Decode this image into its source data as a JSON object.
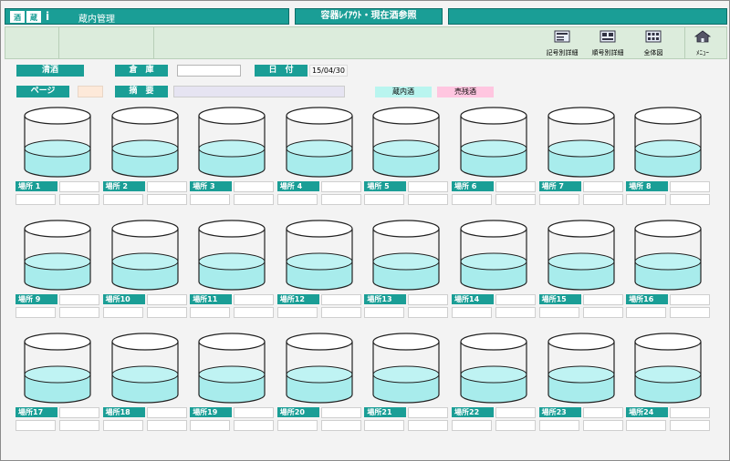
{
  "app": {
    "logo_text": "酒",
    "logo_text2": "蔵",
    "logo_i": "i",
    "title": "蔵内管理",
    "screen_title": "容器ﾚｲｱｳﾄ・現在酒参照"
  },
  "toolbar": {
    "buttons": [
      {
        "label": "記号別詳細",
        "icon": "list-detail-icon"
      },
      {
        "label": "順号別詳細",
        "icon": "order-detail-icon"
      },
      {
        "label": "全体図",
        "icon": "overview-icon"
      },
      {
        "label": "ﾒﾆｭｰ",
        "icon": "home-icon"
      }
    ]
  },
  "header": {
    "mode_label": "清酒",
    "warehouse_label": "倉　庫",
    "warehouse_value": "",
    "date_label": "日　付",
    "date_value": "15/04/30",
    "page_label": "ページ",
    "page_value": "",
    "remarks_label": "摘　要",
    "remarks_value": "",
    "legend_in_stock": "蔵内酒",
    "legend_sold": "売残酒"
  },
  "colors": {
    "teal": "#1a9e96",
    "liquid": "#a8ecec",
    "legend_in_stock": "#b9f5ef",
    "legend_sold": "#ffc6e0"
  },
  "tanks": [
    {
      "label": "場所 1"
    },
    {
      "label": "場所 2"
    },
    {
      "label": "場所 3"
    },
    {
      "label": "場所 4"
    },
    {
      "label": "場所 5"
    },
    {
      "label": "場所 6"
    },
    {
      "label": "場所 7"
    },
    {
      "label": "場所 8"
    },
    {
      "label": "場所 9"
    },
    {
      "label": "場所10"
    },
    {
      "label": "場所11"
    },
    {
      "label": "場所12"
    },
    {
      "label": "場所13"
    },
    {
      "label": "場所14"
    },
    {
      "label": "場所15"
    },
    {
      "label": "場所16"
    },
    {
      "label": "場所17"
    },
    {
      "label": "場所18"
    },
    {
      "label": "場所19"
    },
    {
      "label": "場所20"
    },
    {
      "label": "場所21"
    },
    {
      "label": "場所22"
    },
    {
      "label": "場所23"
    },
    {
      "label": "場所24"
    }
  ]
}
